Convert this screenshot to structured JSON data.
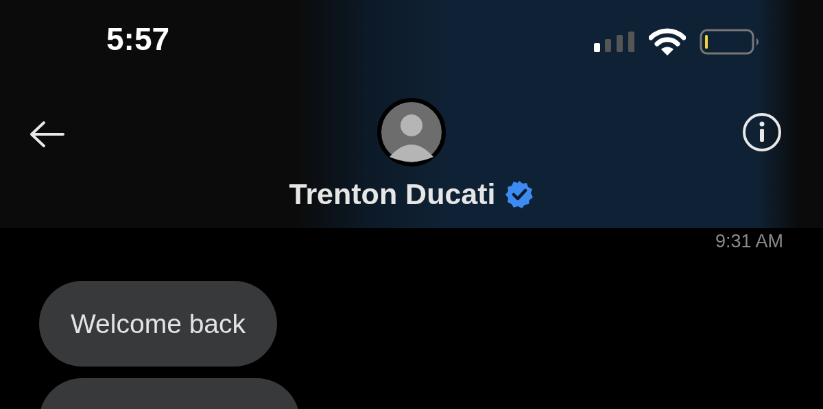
{
  "status_bar": {
    "time": "5:57"
  },
  "header": {
    "name": "Trenton Ducati",
    "verified": true
  },
  "timestamp": "9:31 AM",
  "messages": [
    {
      "kind": "text",
      "text": "Welcome back"
    },
    {
      "kind": "partial"
    }
  ]
}
